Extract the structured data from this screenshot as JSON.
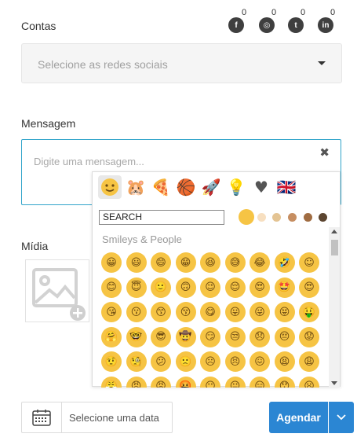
{
  "labels": {
    "contas": "Contas",
    "mensagem": "Mensagem",
    "midia": "Mídia"
  },
  "socials": [
    {
      "name": "facebook",
      "glyph": "f",
      "count": "0"
    },
    {
      "name": "instagram",
      "glyph": "◎",
      "count": "0"
    },
    {
      "name": "twitter",
      "glyph": "t",
      "count": "0"
    },
    {
      "name": "linkedin",
      "glyph": "in",
      "count": "0"
    }
  ],
  "select": {
    "placeholder": "Selecione as redes sociais"
  },
  "message": {
    "placeholder": "Digite uma mensagem...",
    "close_glyph": "✖"
  },
  "picker": {
    "categories": [
      {
        "name": "smileys",
        "glyph": "☺"
      },
      {
        "name": "animals",
        "glyph": "🐹"
      },
      {
        "name": "food",
        "glyph": "🍕"
      },
      {
        "name": "activity",
        "glyph": "🏀"
      },
      {
        "name": "travel",
        "glyph": "🚀"
      },
      {
        "name": "objects",
        "glyph": "💡"
      },
      {
        "name": "symbols",
        "glyph": "♥"
      },
      {
        "name": "flags",
        "glyph": "🇬🇧"
      }
    ],
    "search_value": "SEARCH",
    "tone_colors": [
      "#f6c444",
      "#f7dfc0",
      "#e4c493",
      "#c68e61",
      "#a06c42",
      "#5c4530"
    ],
    "section_title": "Smileys & People",
    "emoji_rows": [
      [
        "😀",
        "😃",
        "😄",
        "😁",
        "😆",
        "😅",
        "😂",
        "🤣",
        "☺"
      ],
      [
        "😊",
        "😇",
        "🙂",
        "🙃",
        "😉",
        "😌",
        "😍",
        "🤩",
        "😍"
      ],
      [
        "😘",
        "😗",
        "😙",
        "😚",
        "😋",
        "😛",
        "😜",
        "😝",
        "🤑"
      ],
      [
        "🤗",
        "🤓",
        "😎",
        "🤠",
        "😏",
        "😒",
        "😞",
        "😔",
        "😟"
      ],
      [
        "🤨",
        "🧐",
        "😕",
        "🙁",
        "☹",
        "😣",
        "😖",
        "😫",
        "😩"
      ],
      [
        "😤",
        "😠",
        "😡",
        "🤬",
        "😶",
        "😐",
        "😑",
        "😯",
        "😦"
      ]
    ]
  },
  "date": {
    "placeholder": "Selecione uma data"
  },
  "agendar": {
    "label": "Agendar"
  },
  "colors": {
    "accent": "#2b86d3",
    "focus_border": "#31a4ca",
    "emoji_yellow": "#f6c444"
  }
}
